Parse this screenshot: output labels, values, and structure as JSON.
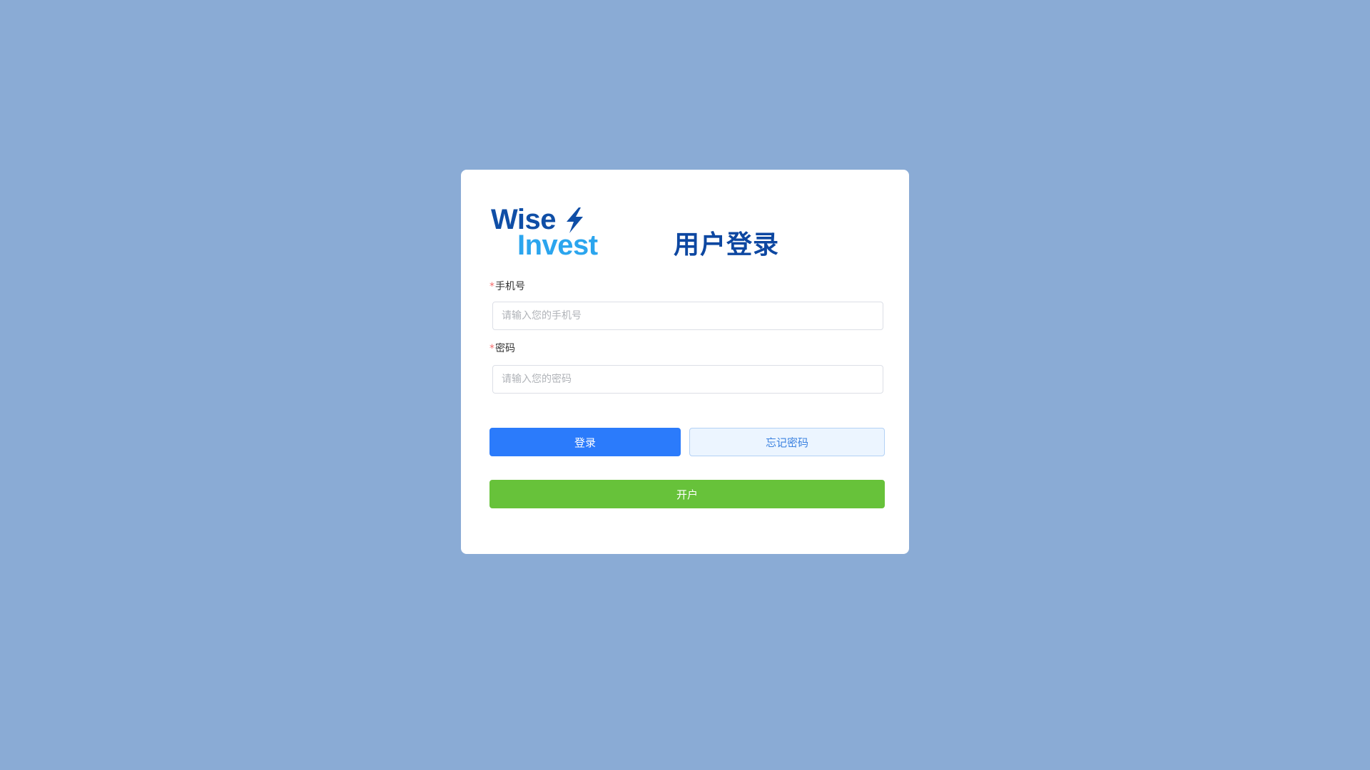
{
  "logo": {
    "line1": "Wise",
    "line2": "Invest",
    "bolt_icon": "lightning-bolt-icon",
    "colors": {
      "line1": "#0f4ea6",
      "line2": "#2ba5ee"
    }
  },
  "title": "用户登录",
  "form": {
    "phone": {
      "required_mark": "*",
      "label": "手机号",
      "placeholder": "请输入您的手机号",
      "value": ""
    },
    "password": {
      "required_mark": "*",
      "label": "密码",
      "placeholder": "请输入您的密码",
      "value": ""
    }
  },
  "buttons": {
    "login": "登录",
    "forgot": "忘记密码",
    "open_account": "开户"
  },
  "colors": {
    "background": "#8aabd5",
    "primary": "#2b7bfb",
    "success": "#67c23a",
    "title": "#0d47a1"
  }
}
